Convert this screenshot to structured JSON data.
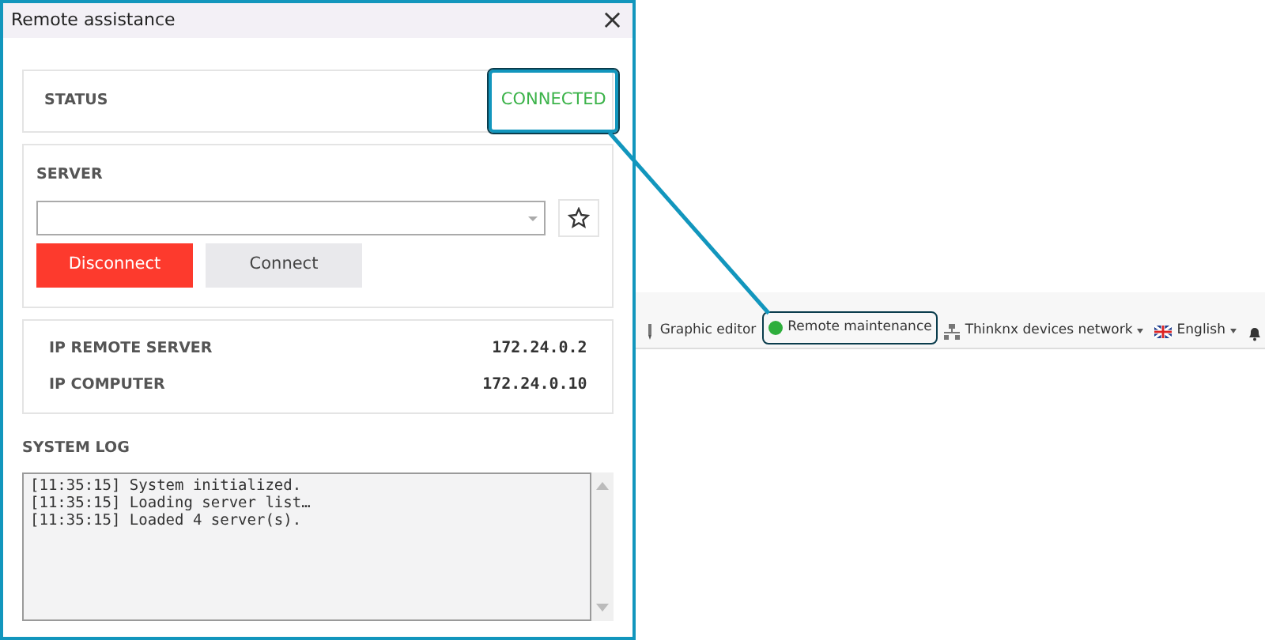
{
  "window": {
    "title": "Remote assistance",
    "close": "×"
  },
  "status": {
    "label": "STATUS",
    "value": "CONNECTED",
    "highlighted": true
  },
  "server": {
    "label": "SERVER",
    "buttons": [
      {
        "label": "Disconnect",
        "kind": "danger"
      },
      {
        "label": "Connect",
        "kind": "plain"
      }
    ]
  },
  "info": [
    {
      "label": "IP REMOTE SERVER",
      "value": "172.24.0.2"
    },
    {
      "label": "IP COMPUTER",
      "value": "172.24.0.10"
    }
  ],
  "log": {
    "label": "SYSTEM LOG",
    "lines": [
      "[11:35:15] System initialized.",
      "[11:35:15] Loading server list…",
      "[11:35:15] Loaded 4 server(s)."
    ]
  },
  "toolbar": [
    {
      "label": "Graphic editor",
      "kind": "editor",
      "has_menu": false,
      "highlighted": false
    },
    {
      "label": "Remote maintenance",
      "kind": "status",
      "color": "#2eae3c",
      "has_menu": false,
      "highlighted": true
    },
    {
      "label": "Thinknx devices network",
      "kind": "network",
      "has_menu": true,
      "highlighted": false
    },
    {
      "label": "English",
      "kind": "flag",
      "has_menu": true,
      "highlighted": false
    },
    {
      "kind": "bell",
      "has_menu": false,
      "highlighted": false
    }
  ]
}
